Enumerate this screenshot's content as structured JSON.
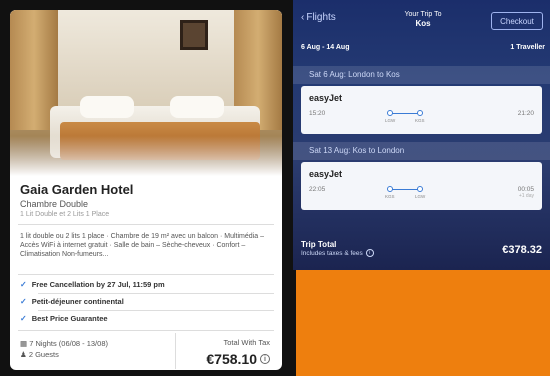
{
  "hotel": {
    "name": "Gaia Garden Hotel",
    "room_type": "Chambre Double",
    "room_detail": "1 Lit Double et 2 Lits 1 Place",
    "description": "1 lit double ou 2 lits 1 place · Chambre de 19 m² avec un balcon · Multimédia – Accès WiFi à internet gratuit · Salle de bain – Sèche-cheveux · Confort – Climatisation Non-fumeurs...",
    "features": [
      "Free Cancellation by 27 Jul, 11:59 pm",
      "Petit-déjeuner continental",
      "Best Price Guarantee"
    ],
    "nights": "7 Nights (06/08 - 13/08)",
    "guests": "2 Guests",
    "total_label": "Total With Tax",
    "total_price": "€758.10",
    "info_icon": "i"
  },
  "trip": {
    "back_label": "Flights",
    "title_line1": "Your Trip To",
    "title_line2": "Kos",
    "checkout_label": "Checkout",
    "date_range": "6 Aug - 14 Aug",
    "travellers": "1 Traveller",
    "segments": [
      {
        "header": "Sat 6 Aug: London to Kos",
        "airline": "easyJet",
        "dep_time": "15:20",
        "arr_time": "21:20",
        "arr_sub": "",
        "from_code": "LGW",
        "to_code": "KGS"
      },
      {
        "header": "Sat 13 Aug: Kos to London",
        "airline": "easyJet",
        "dep_time": "22:05",
        "arr_time": "00:05",
        "arr_sub": "+1 day",
        "from_code": "KGS",
        "to_code": "LGW"
      }
    ],
    "total_label": "Trip Total",
    "total_sub": "Includes taxes & fees",
    "total_price": "€378.32"
  },
  "colors": {
    "background": "#EE7F0E",
    "accent": "#3a7bd5",
    "navy": "#1b2e6b"
  }
}
